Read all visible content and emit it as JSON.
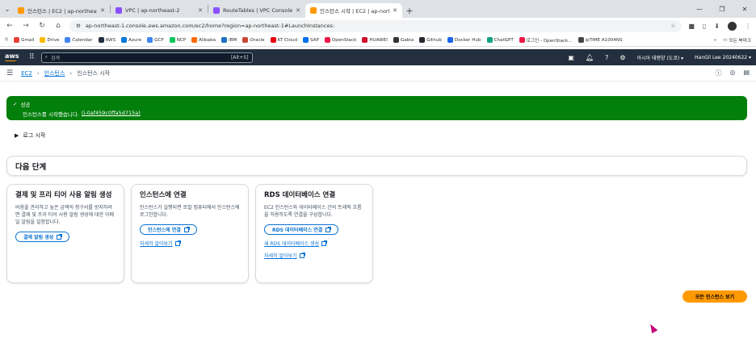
{
  "browser": {
    "tabs": [
      {
        "title": "인스턴스 | EC2 | ap-northeast",
        "favicon_color": "#ff9900",
        "active": false
      },
      {
        "title": "VPC | ap-northeast-2",
        "favicon_color": "#8c4fff",
        "active": false
      },
      {
        "title": "RouteTables | VPC Console",
        "favicon_color": "#8c4fff",
        "active": false
      },
      {
        "title": "인스턴스 시작 | EC2 | ap-north",
        "favicon_color": "#ff9900",
        "active": true
      }
    ],
    "url": "ap-northeast-1.console.aws.amazon.com/ec2/home?region=ap-northeast-1#LaunchInstances:",
    "bookmarks": [
      {
        "label": "Gmail",
        "color": "#ea4335"
      },
      {
        "label": "Drive",
        "color": "#fbbc04"
      },
      {
        "label": "Calendar",
        "color": "#4285f4"
      },
      {
        "label": "AWS",
        "color": "#232f3e"
      },
      {
        "label": "Azure",
        "color": "#0078d4"
      },
      {
        "label": "GCP",
        "color": "#4285f4"
      },
      {
        "label": "NCP",
        "color": "#03c75a"
      },
      {
        "label": "Alibaba",
        "color": "#ff6a00"
      },
      {
        "label": "IBM",
        "color": "#1f70c1"
      },
      {
        "label": "Oracle",
        "color": "#c74634"
      },
      {
        "label": "KT Cloud",
        "color": "#e60012"
      },
      {
        "label": "SAP",
        "color": "#0070f2"
      },
      {
        "label": "OpenStack",
        "color": "#ed1944"
      },
      {
        "label": "HUAWEI",
        "color": "#cf0a2c"
      },
      {
        "label": "Gabia",
        "color": "#333333"
      },
      {
        "label": "Github",
        "color": "#24292f"
      },
      {
        "label": "Docker Hub",
        "color": "#1d63ed"
      },
      {
        "label": "ChatGPT",
        "color": "#10a37f"
      },
      {
        "label": "로그인 - OpenStack...",
        "color": "#ed1944"
      },
      {
        "label": "ipTIME A1004NS",
        "color": "#444444"
      }
    ],
    "all_bookmarks": "모든 북마크"
  },
  "aws_nav": {
    "logo": "aws",
    "search_placeholder": "검색",
    "search_shortcut": "[Alt+S]",
    "region": "아시아 태평양 (도쿄)",
    "account": "HanGil Lee 20240622"
  },
  "breadcrumb": {
    "items": [
      "EC2",
      "인스턴스"
    ],
    "current": "인스턴스 시작"
  },
  "flash": {
    "title": "성공",
    "message": "인스턴스를 시작했습니다.",
    "instance_id": "(i-0af459c0ffa5d715a)",
    "color": "#037f0c"
  },
  "log_toggle": "로그 시작",
  "next_steps": {
    "title": "다음 단계",
    "cards": [
      {
        "title": "결제 및 프리 티어 사용 알림 생성",
        "description": "비용을 관리하고 높은 금액의 청구서를 방지하려면 결제 및 프리 티어 사용 알림 생성에 대한 이메일 알림을 설정합니다.",
        "button": "결제 알림 생성",
        "links": []
      },
      {
        "title": "인스턴스에 연결",
        "description": "인스턴스가 실행되면 로컬 컴퓨터에서 인스턴스에 로그인합니다.",
        "button": "인스턴스에 연결",
        "links": [
          "자세히 알아보기"
        ]
      },
      {
        "title": "RDS 데이터베이스 연결",
        "description": "EC2 인스턴스와 데이터베이스 간의 트래픽 흐름을 허용하도록 연결을 구성합니다.",
        "button": "RDS 데이터베이스 연결",
        "links": [
          "새 RDS 데이터베이스 생성",
          "자세히 알아보기"
        ]
      }
    ]
  },
  "view_all_button": "모든 인스턴스 보기",
  "colors": {
    "accent": "#ff9900",
    "link": "#0972d3",
    "nav_bg": "#232f3e"
  }
}
